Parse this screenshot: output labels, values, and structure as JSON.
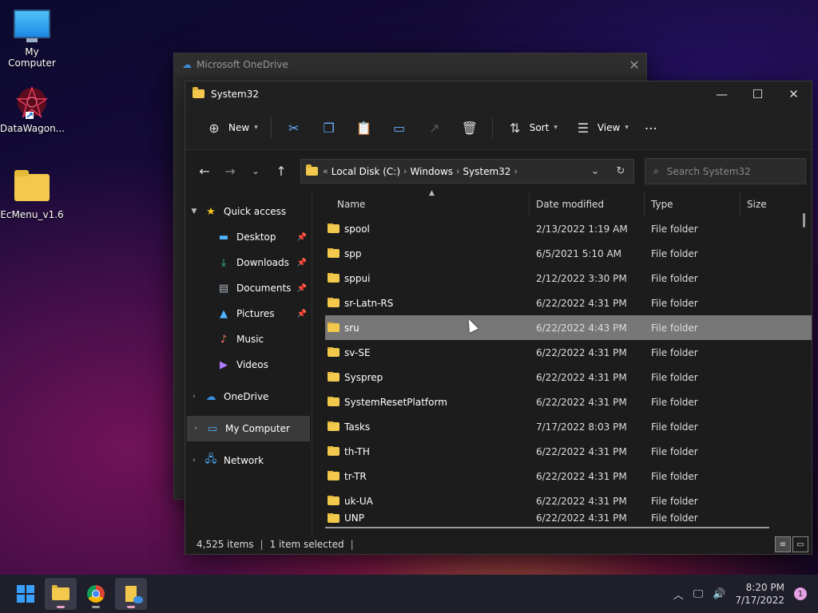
{
  "desktop": {
    "icons": [
      {
        "label": "My Computer",
        "icon": "monitor-icon"
      },
      {
        "label": "DataWagon...",
        "icon": "datawagon-icon"
      },
      {
        "label": "EcMenu_v1.6",
        "icon": "folder-icon"
      }
    ]
  },
  "onedrive_window": {
    "title": "Microsoft OneDrive"
  },
  "explorer": {
    "title": "System32",
    "toolbar": {
      "new_label": "New",
      "sort_label": "Sort",
      "view_label": "View",
      "more_label": "⋯"
    },
    "address": {
      "prefix": "«",
      "crumbs": [
        "Local Disk (C:)",
        "Windows",
        "System32"
      ]
    },
    "search": {
      "placeholder": "Search System32"
    },
    "sidebar": {
      "quick_access": "Quick access",
      "items": [
        {
          "label": "Desktop",
          "icon": "desktop-icon",
          "pinned": true
        },
        {
          "label": "Downloads",
          "icon": "downloads-icon",
          "pinned": true
        },
        {
          "label": "Documents",
          "icon": "documents-icon",
          "pinned": true
        },
        {
          "label": "Pictures",
          "icon": "pictures-icon",
          "pinned": true
        },
        {
          "label": "Music",
          "icon": "music-icon",
          "pinned": false
        },
        {
          "label": "Videos",
          "icon": "videos-icon",
          "pinned": false
        }
      ],
      "onedrive": "OneDrive",
      "my_computer": "My Computer",
      "network": "Network"
    },
    "columns": {
      "name": "Name",
      "date": "Date modified",
      "type": "Type",
      "size": "Size"
    },
    "files": [
      {
        "name": "spool",
        "date": "2/13/2022 1:19 AM",
        "type": "File folder"
      },
      {
        "name": "spp",
        "date": "6/5/2021 5:10 AM",
        "type": "File folder"
      },
      {
        "name": "sppui",
        "date": "2/12/2022 3:30 PM",
        "type": "File folder"
      },
      {
        "name": "sr-Latn-RS",
        "date": "6/22/2022 4:31 PM",
        "type": "File folder"
      },
      {
        "name": "sru",
        "date": "6/22/2022 4:43 PM",
        "type": "File folder",
        "selected": true
      },
      {
        "name": "sv-SE",
        "date": "6/22/2022 4:31 PM",
        "type": "File folder"
      },
      {
        "name": "Sysprep",
        "date": "6/22/2022 4:31 PM",
        "type": "File folder"
      },
      {
        "name": "SystemResetPlatform",
        "date": "6/22/2022 4:31 PM",
        "type": "File folder"
      },
      {
        "name": "Tasks",
        "date": "7/17/2022 8:03 PM",
        "type": "File folder"
      },
      {
        "name": "th-TH",
        "date": "6/22/2022 4:31 PM",
        "type": "File folder"
      },
      {
        "name": "tr-TR",
        "date": "6/22/2022 4:31 PM",
        "type": "File folder"
      },
      {
        "name": "uk-UA",
        "date": "6/22/2022 4:31 PM",
        "type": "File folder"
      },
      {
        "name": "UNP",
        "date": "6/22/2022 4:31 PM",
        "type": "File folder"
      }
    ],
    "status": {
      "count": "4,525 items",
      "selection": "1 item selected"
    }
  },
  "taskbar": {
    "apps": [
      "start-icon",
      "file-explorer-icon",
      "chrome-icon",
      "app-icon"
    ],
    "time": "8:20 PM",
    "date": "7/17/2022",
    "notifications": "1"
  },
  "colors": {
    "accent": "#6ab0ff",
    "folder": "#f2c94c",
    "selection": "#777777"
  }
}
